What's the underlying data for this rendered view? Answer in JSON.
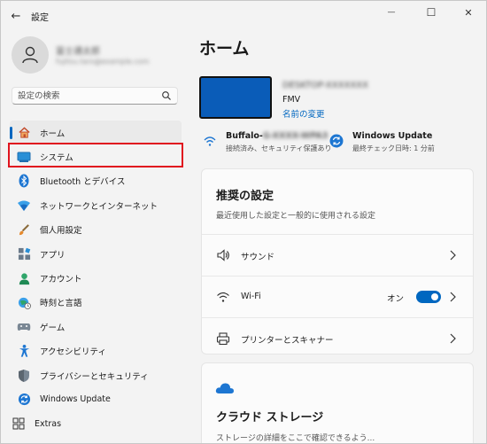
{
  "window": {
    "title": "設定",
    "minimize_glyph": "—",
    "maximize_glyph": "☐",
    "close_glyph": "✕",
    "back_glyph": "←"
  },
  "profile": {
    "name": "富士通太郎",
    "email": "fujitsu.taro@example.com"
  },
  "search": {
    "placeholder": "設定の検索"
  },
  "sidebar": {
    "items": [
      {
        "label": "ホーム",
        "icon": "home-icon",
        "active": true
      },
      {
        "label": "システム",
        "icon": "system-icon"
      },
      {
        "label": "Bluetooth とデバイス",
        "icon": "bluetooth-icon"
      },
      {
        "label": "ネットワークとインターネット",
        "icon": "network-icon"
      },
      {
        "label": "個人用設定",
        "icon": "personalization-icon"
      },
      {
        "label": "アプリ",
        "icon": "apps-icon"
      },
      {
        "label": "アカウント",
        "icon": "accounts-icon"
      },
      {
        "label": "時刻と言語",
        "icon": "time-language-icon"
      },
      {
        "label": "ゲーム",
        "icon": "gaming-icon"
      },
      {
        "label": "アクセシビリティ",
        "icon": "accessibility-icon"
      },
      {
        "label": "プライバシーとセキュリティ",
        "icon": "privacy-icon"
      },
      {
        "label": "Windows Update",
        "icon": "windows-update-icon"
      },
      {
        "label": "Extras",
        "icon": "extras-icon"
      }
    ]
  },
  "main": {
    "title": "ホーム",
    "device": {
      "name": "DESKTOP-XXXXXXX",
      "model": "FMV",
      "rename_link": "名前の変更"
    },
    "wifi_status": {
      "title_prefix": "Buffalo-",
      "title_hidden": "G-XXXX-WPA3",
      "subtitle": "接続済み、セキュリティ保護あり"
    },
    "update_status": {
      "title": "Windows Update",
      "subtitle": "最終チェック日時: 1 分前"
    },
    "recommended": {
      "title": "推奨の設定",
      "subtitle": "最近使用した設定と一般的に使用される設定",
      "rows": [
        {
          "label": "サウンド",
          "icon": "speaker-icon"
        },
        {
          "label": "Wi-Fi",
          "icon": "wifi-icon",
          "toggle_state": "オン",
          "toggle_on": true
        },
        {
          "label": "プリンターとスキャナー",
          "icon": "printer-icon"
        }
      ]
    },
    "cloud": {
      "title": "クラウド ストレージ",
      "subtitle": "ストレージの詳細をここで確認できるよう..."
    }
  },
  "colors": {
    "accent": "#0067c0",
    "highlight_box": "#e0141e",
    "device_thumb": "#0a5cb8"
  }
}
